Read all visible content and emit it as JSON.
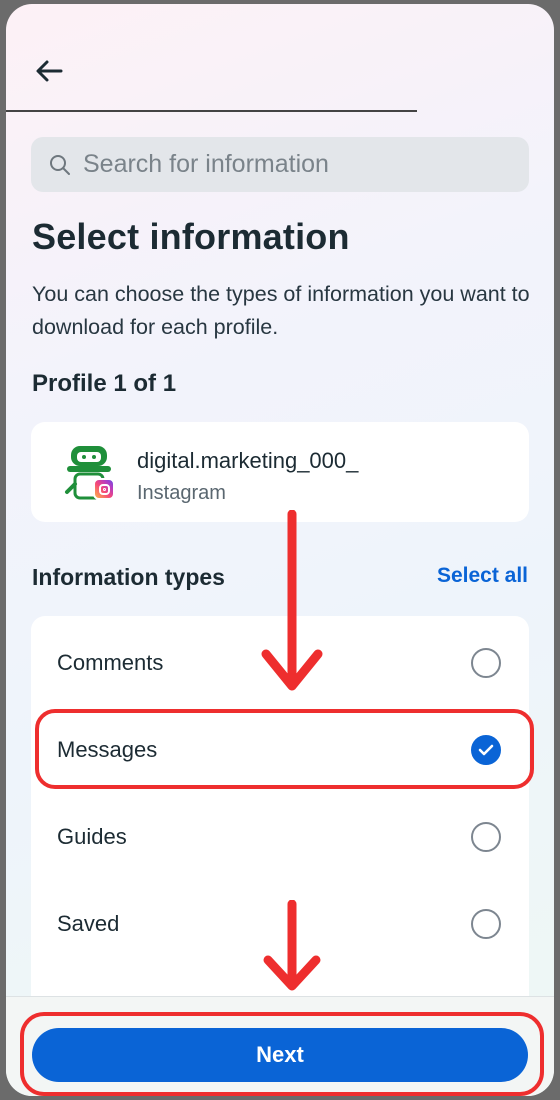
{
  "header": {
    "back_icon": "arrow-left-icon"
  },
  "search": {
    "placeholder": "Search for information",
    "icon": "search-icon"
  },
  "page": {
    "title": "Select information",
    "description": "You can choose the types of information you want to download for each profile.",
    "profile_count": "Profile 1 of 1"
  },
  "profile": {
    "name": "digital.marketing_000_",
    "platform": "Instagram"
  },
  "info_types": {
    "header": "Information types",
    "select_all": "Select all",
    "items": [
      {
        "label": "Comments",
        "selected": false
      },
      {
        "label": "Messages",
        "selected": true
      },
      {
        "label": "Guides",
        "selected": false
      },
      {
        "label": "Saved",
        "selected": false
      }
    ]
  },
  "footer": {
    "next_label": "Next"
  },
  "colors": {
    "accent": "#0a64d6",
    "annotation": "#ee2e2e"
  }
}
